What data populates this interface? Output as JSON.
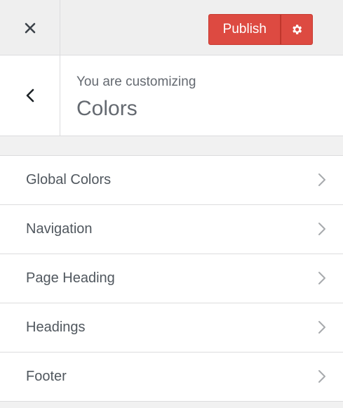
{
  "header": {
    "close_icon": "close-icon",
    "publish_label": "Publish",
    "settings_icon": "gear-icon",
    "accent_color": "#dd4a41"
  },
  "context": {
    "back_icon": "chevron-left-icon",
    "subtitle": "You are customizing",
    "title": "Colors"
  },
  "menu": {
    "items": [
      {
        "label": "Global Colors",
        "icon": "chevron-right-icon"
      },
      {
        "label": "Navigation",
        "icon": "chevron-right-icon"
      },
      {
        "label": "Page Heading",
        "icon": "chevron-right-icon"
      },
      {
        "label": "Headings",
        "icon": "chevron-right-icon"
      },
      {
        "label": "Footer",
        "icon": "chevron-right-icon"
      }
    ]
  }
}
